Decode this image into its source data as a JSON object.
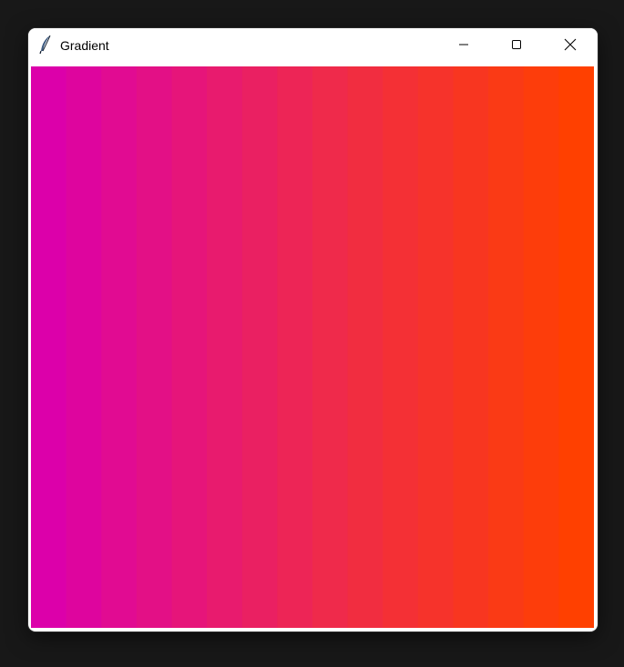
{
  "window": {
    "title": "Gradient",
    "controls": {
      "minimize": "minimize-icon",
      "maximize": "maximize-icon",
      "close": "close-icon"
    }
  },
  "canvas": {
    "gradient_direction": "left-to-right",
    "start_color": "#DC00AA",
    "mid_color": "#EE2850",
    "end_color": "#FF4000",
    "stripe_count": 16
  }
}
